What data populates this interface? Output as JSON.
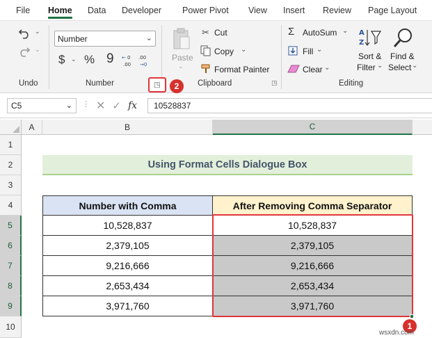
{
  "menu": {
    "tabs": [
      "File",
      "Home",
      "Data",
      "Developer",
      "Power Pivot",
      "View",
      "Insert",
      "Review",
      "Page Layout"
    ],
    "active": "Home"
  },
  "ribbon": {
    "undo_group_label": "Undo",
    "number": {
      "format_value": "Number",
      "currency_symbol": "$",
      "percent_symbol": "%",
      "comma_symbol": "9",
      "group_label": "Number"
    },
    "clipboard": {
      "paste_label": "Paste",
      "cut_label": "Cut",
      "copy_label": "Copy",
      "format_painter_label": "Format Painter",
      "group_label": "Clipboard"
    },
    "editing": {
      "autosum_label": "AutoSum",
      "fill_label": "Fill",
      "clear_label": "Clear",
      "sort_filter_label_1": "Sort &",
      "sort_filter_label_2": "Filter",
      "find_select_label_1": "Find &",
      "find_select_label_2": "Select",
      "group_label": "Editing"
    }
  },
  "badges": {
    "one": "1",
    "two": "2"
  },
  "formula_bar": {
    "name_box": "C5",
    "fx": "fx",
    "value": "10528837"
  },
  "grid": {
    "columns": [
      "A",
      "B",
      "C"
    ],
    "rows": [
      "1",
      "2",
      "3",
      "4",
      "5",
      "6",
      "7",
      "8",
      "9",
      "10"
    ],
    "title": "Using Format Cells Dialogue Box",
    "header_b": "Number with Comma",
    "header_c": "After Removing Comma Separator",
    "data_b": [
      "10,528,837",
      "2,379,105",
      "9,216,666",
      "2,653,434",
      "3,971,760"
    ],
    "data_c": [
      "10,528,837",
      "2,379,105",
      "9,216,666",
      "2,653,434",
      "3,971,760"
    ]
  },
  "colors": {
    "accent_green": "#217346",
    "highlight_red": "#e0353b",
    "header_blue": "#dae3f3",
    "header_yellow": "#fff2cc",
    "title_green": "#e2efda",
    "selected_gray": "#c9c9c9"
  },
  "watermark": "wsxdn.com"
}
